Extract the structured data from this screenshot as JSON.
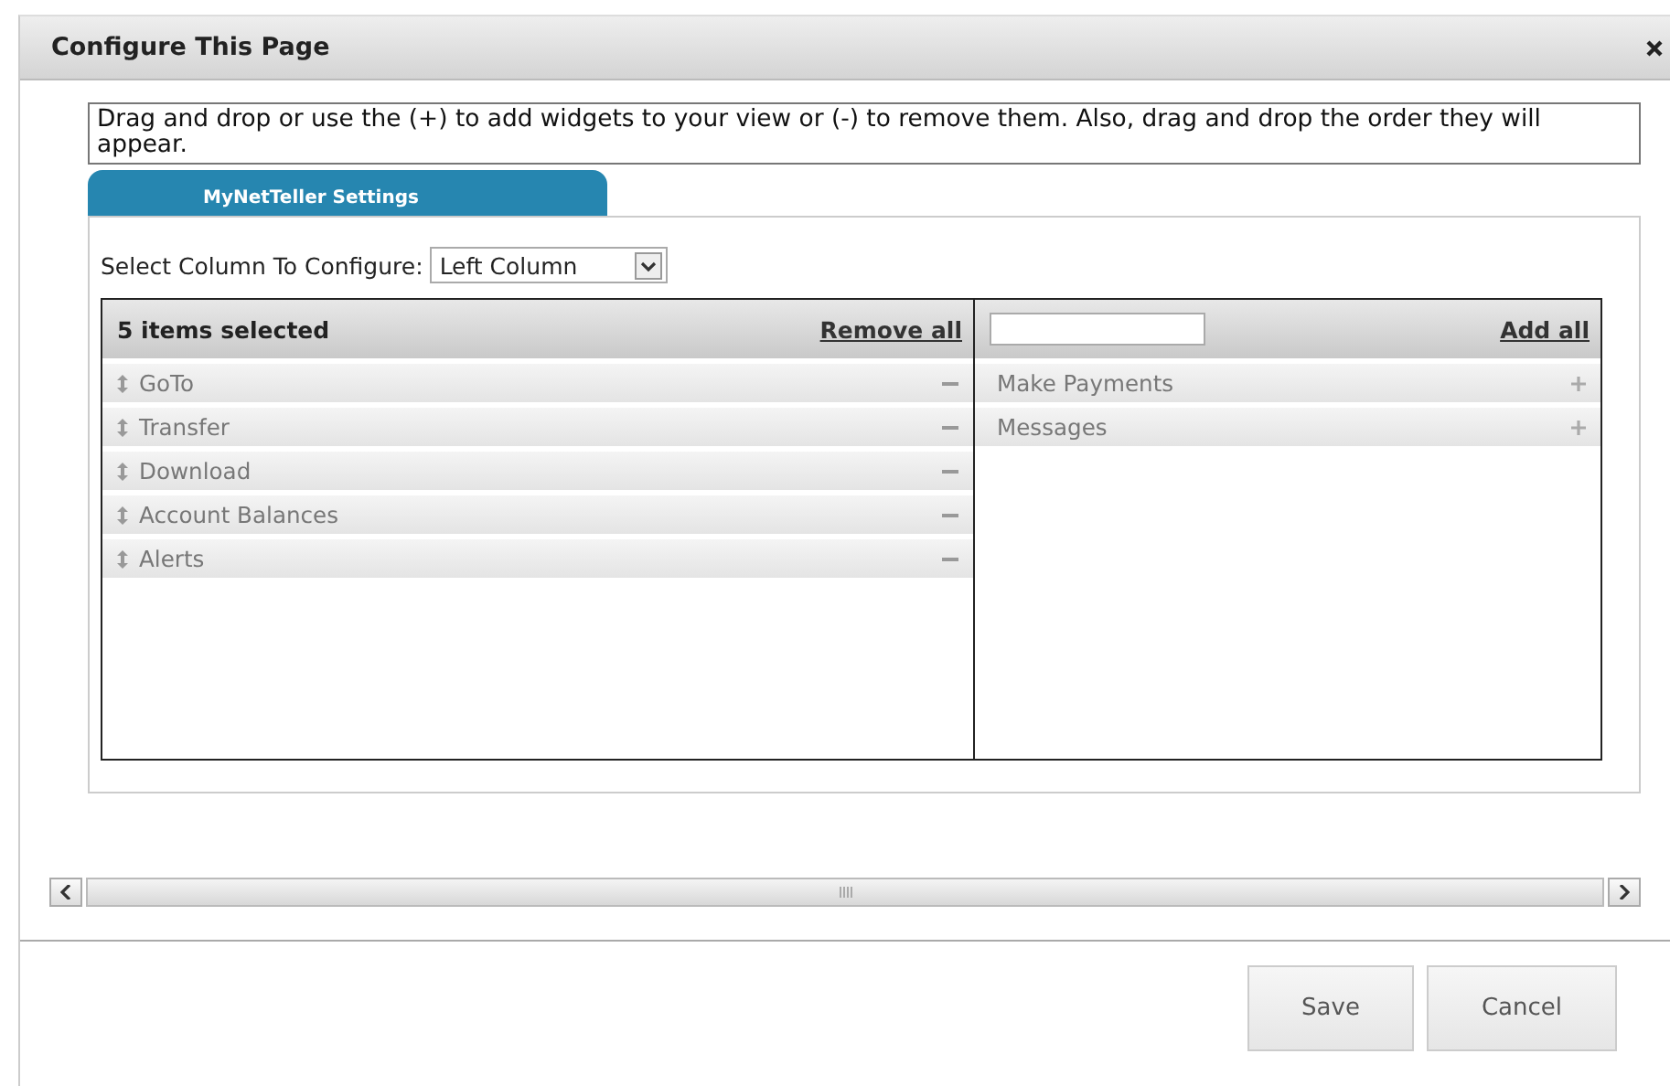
{
  "dialog": {
    "title": "Configure This Page"
  },
  "instructions": "Drag and drop or use the (+) to add widgets to your view or (-) to remove them. Also, drag and drop the order they will appear.",
  "tabs": [
    {
      "label": "MyNetTeller Settings",
      "selected": true
    }
  ],
  "column_select": {
    "label": "Select Column To Configure:",
    "value": "Left Column"
  },
  "selected_list": {
    "header": "5 items selected",
    "action": "Remove all",
    "items": [
      {
        "label": "GoTo"
      },
      {
        "label": "Transfer"
      },
      {
        "label": "Download"
      },
      {
        "label": "Account Balances"
      },
      {
        "label": "Alerts"
      }
    ]
  },
  "available_list": {
    "action": "Add all",
    "items": [
      {
        "label": "Make Payments"
      },
      {
        "label": "Messages"
      }
    ]
  },
  "buttons": [
    "Save",
    "Cancel"
  ]
}
